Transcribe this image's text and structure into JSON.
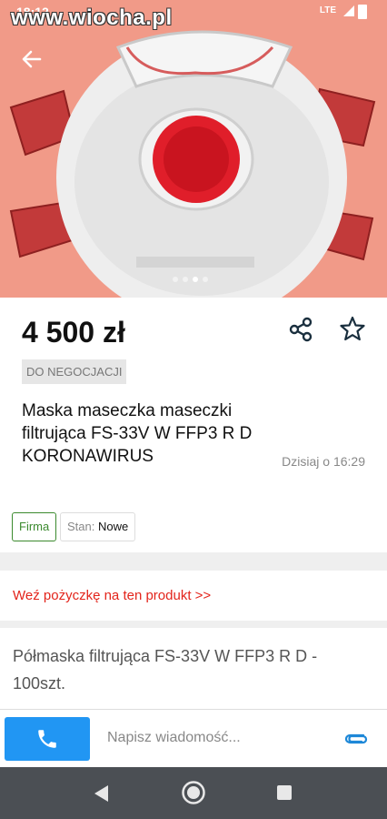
{
  "status_bar": {
    "time": "18:12",
    "network": "LTE"
  },
  "watermark": "www.wiocha.pl",
  "gallery": {
    "dots": 4,
    "active_index": 2
  },
  "listing": {
    "price": "4 500 zł",
    "negotiable_label": "DO NEGOCJACJI",
    "title": "Maska maseczka maseczki filtrująca FS-33V W FFP3 R D KORONAWIRUS",
    "date": "Dzisiaj o 16:29",
    "seller_type": "Firma",
    "condition_label": "Stan:",
    "condition_value": "Nowe"
  },
  "loan_link": "Weź pożyczkę na ten produkt >>",
  "description": "Półmaska filtrująca FS-33V W FFP3 R D - 100szt.",
  "compose": {
    "placeholder": "Napisz wiadomość..."
  },
  "icons": {
    "back": "arrow-left-icon",
    "share": "share-icon",
    "favorite": "star-outline-icon",
    "call": "phone-icon",
    "attach": "paperclip-icon"
  },
  "colors": {
    "accent": "#2196f3",
    "link_red": "#e3241b",
    "firma_green": "#3b8a2e",
    "hero_bg": "#f19a88"
  }
}
